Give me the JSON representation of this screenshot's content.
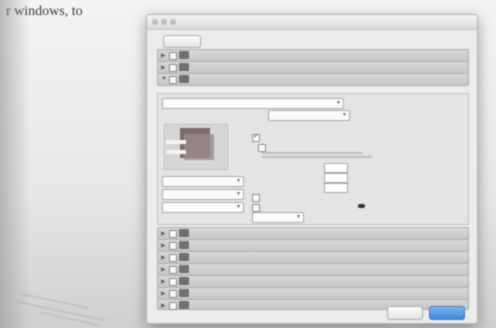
{
  "background_doc": {
    "visible_text": "r windows, to"
  },
  "window": {
    "title": "",
    "toolbar": {
      "left_button_label": "",
      "right_text": ""
    },
    "sections_top": [
      {
        "label": "",
        "icon": "image-icon"
      },
      {
        "label": "",
        "icon": "image-icon"
      },
      {
        "label": "",
        "icon": "image-icon"
      }
    ],
    "panel": {
      "preset_select": "",
      "action_select": "",
      "group_label": "",
      "checkboxes": [
        {
          "label": "",
          "checked": true
        },
        {
          "label": "",
          "checked": false
        },
        {
          "label": "",
          "checked": false
        },
        {
          "label": "",
          "checked": false
        }
      ],
      "fields": [
        {
          "label": "",
          "value": ""
        },
        {
          "label": "",
          "value": ""
        },
        {
          "label": "",
          "value": ""
        }
      ],
      "lower_selects": [
        "",
        "",
        ""
      ]
    },
    "sections_bottom": [
      {
        "label": "",
        "icon": "image-icon"
      },
      {
        "label": "",
        "icon": "image-icon"
      },
      {
        "label": "",
        "icon": "image-icon"
      },
      {
        "label": "",
        "icon": "image-icon"
      },
      {
        "label": "",
        "icon": "image-icon"
      },
      {
        "label": "",
        "icon": "image-icon"
      },
      {
        "label": "",
        "icon": "image-icon"
      }
    ],
    "footer": {
      "cancel_label": "",
      "ok_label": ""
    }
  }
}
